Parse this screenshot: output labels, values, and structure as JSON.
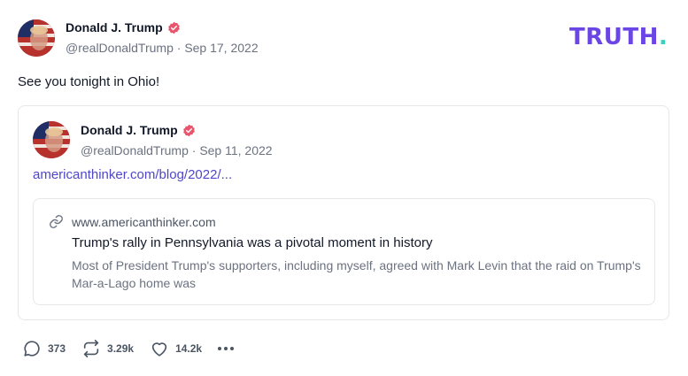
{
  "brand": {
    "logo_text": "TRUTH",
    "logo_dot": ".",
    "primary_color": "#6b46e5",
    "accent_color": "#36d3bd"
  },
  "post": {
    "author": {
      "name": "Donald J. Trump",
      "handle": "@realDonaldTrump",
      "date": "Sep 17, 2022"
    },
    "separator": "·",
    "text": "See you tonight in Ohio!",
    "quoted": {
      "author": {
        "name": "Donald J. Trump",
        "handle": "@realDonaldTrump",
        "date": "Sep 11, 2022"
      },
      "link_text": "americanthinker.com/blog/2022/...",
      "card": {
        "domain": "www.americanthinker.com",
        "title": "Trump's rally in Pennsylvania was a pivotal moment in history",
        "description": "Most of President Trump's supporters, including myself, agreed with Mark Levin that the raid on Trump's Mar-a-Lago home was"
      }
    },
    "actions": {
      "replies": "373",
      "retruths": "3.29k",
      "likes": "14.2k"
    }
  },
  "icons": {
    "verified": "verified-badge-icon",
    "link": "link-icon",
    "reply": "reply-icon",
    "retruth": "retruth-icon",
    "like": "heart-icon",
    "more": "more-dots-icon"
  },
  "verified_color": "#e8556d"
}
